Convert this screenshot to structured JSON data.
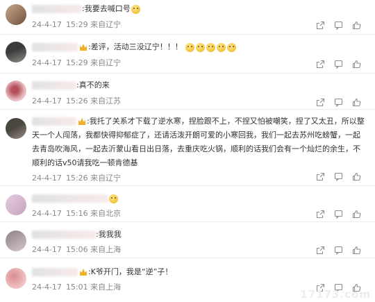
{
  "comments": [
    {
      "text": ":我要去喊口号",
      "emojis": 1,
      "badge": false,
      "date": "24-4-17",
      "time": "15:29",
      "location": "来自辽宁",
      "avatar_colors": [
        "#c9a98a",
        "#6e5040"
      ]
    },
    {
      "text": ":差评，活动三没辽宁！！！",
      "emojis": 5,
      "badge": true,
      "date": "24-4-17",
      "time": "15:29",
      "location": "来自辽宁",
      "avatar_colors": [
        "#3b3b3b",
        "#8a8f86"
      ]
    },
    {
      "text": ":真不的来",
      "emojis": 0,
      "badge": false,
      "date": "24-4-17",
      "time": "15:26",
      "location": "来自江苏",
      "avatar_colors": [
        "#e8b9bf",
        "#b44e58"
      ]
    },
    {
      "text": ":我托了关系才下载了逆水寒，捏脸跟不上，不捏又怕被嘲笑，捏了又太丑，所以整天一个人闯荡，我都快得抑郁症了，还请活泼开朗可爱的小寒回我，我们一起去苏州吃螃蟹，一起去青岛吹海风，一起去沂蒙山看日出日落，去重庆吃火锅，顺利的话我们会有一个灿烂的余生，不顺利的话v50请我吃一顿肯德基",
      "emojis": 0,
      "badge": true,
      "date": "24-4-17",
      "time": "15:26",
      "location": "来自辽宁",
      "avatar_colors": [
        "#4a4640",
        "#9a8f82"
      ]
    },
    {
      "text": "",
      "emojis": 1,
      "badge": false,
      "date": "24-4-17",
      "time": "15:16",
      "location": "来自北京",
      "avatar_colors": [
        "#e3cfe0",
        "#c99fbf"
      ]
    },
    {
      "text": ":我我我",
      "emojis": 0,
      "badge": false,
      "date": "24-4-17",
      "time": "15:06",
      "location": "来自上海",
      "avatar_colors": [
        "#8d7f86",
        "#d6c7cb"
      ]
    },
    {
      "text": ":K爷开门，我是“逆”子！",
      "emojis": 0,
      "badge": true,
      "date": "24-4-17",
      "time": "15:01",
      "location": "来自上海",
      "avatar_colors": [
        "#d88c8f",
        "#f3c9ca"
      ]
    }
  ],
  "watermark": "17173.com"
}
